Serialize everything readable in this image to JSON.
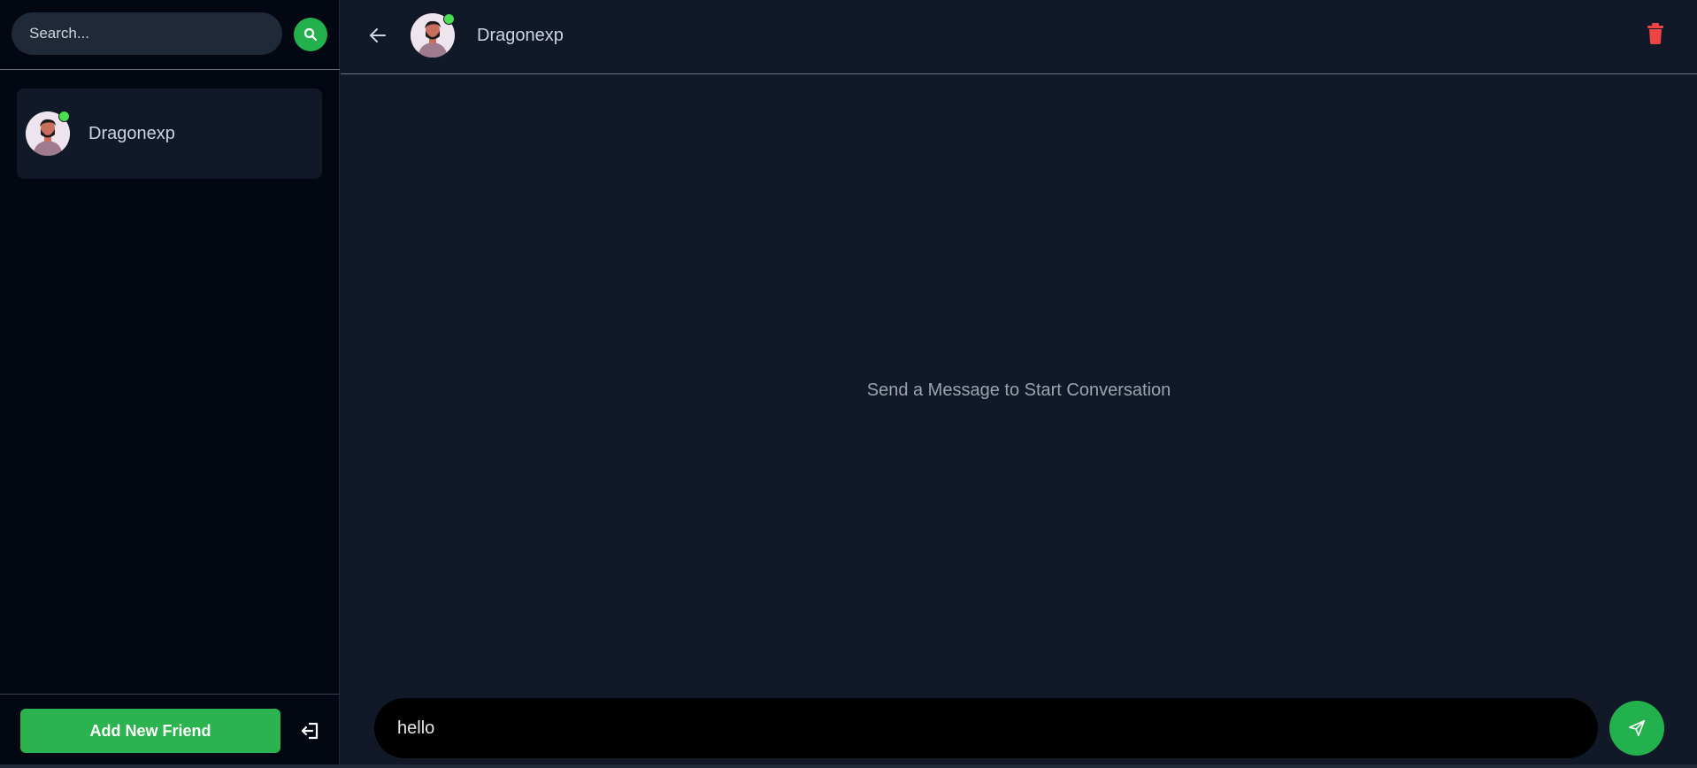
{
  "sidebar": {
    "search": {
      "placeholder": "Search..."
    },
    "contacts": [
      {
        "name": "Dragonexp",
        "online": true
      }
    ],
    "add_friend_label": "Add New Friend"
  },
  "chat": {
    "header": {
      "name": "Dragonexp",
      "online": true
    },
    "empty_message": "Send a Message to Start Conversation",
    "composer": {
      "value": "hello"
    }
  },
  "icons": {
    "search": "search-icon",
    "logout": "logout-icon",
    "back": "arrow-left-icon",
    "delete": "trash-icon",
    "send": "paper-plane-icon"
  },
  "colors": {
    "accent": "#22b14c",
    "online": "#4ade50",
    "danger": "#ef4444",
    "sidebar_bg": "#030712",
    "chat_bg": "#111827"
  }
}
